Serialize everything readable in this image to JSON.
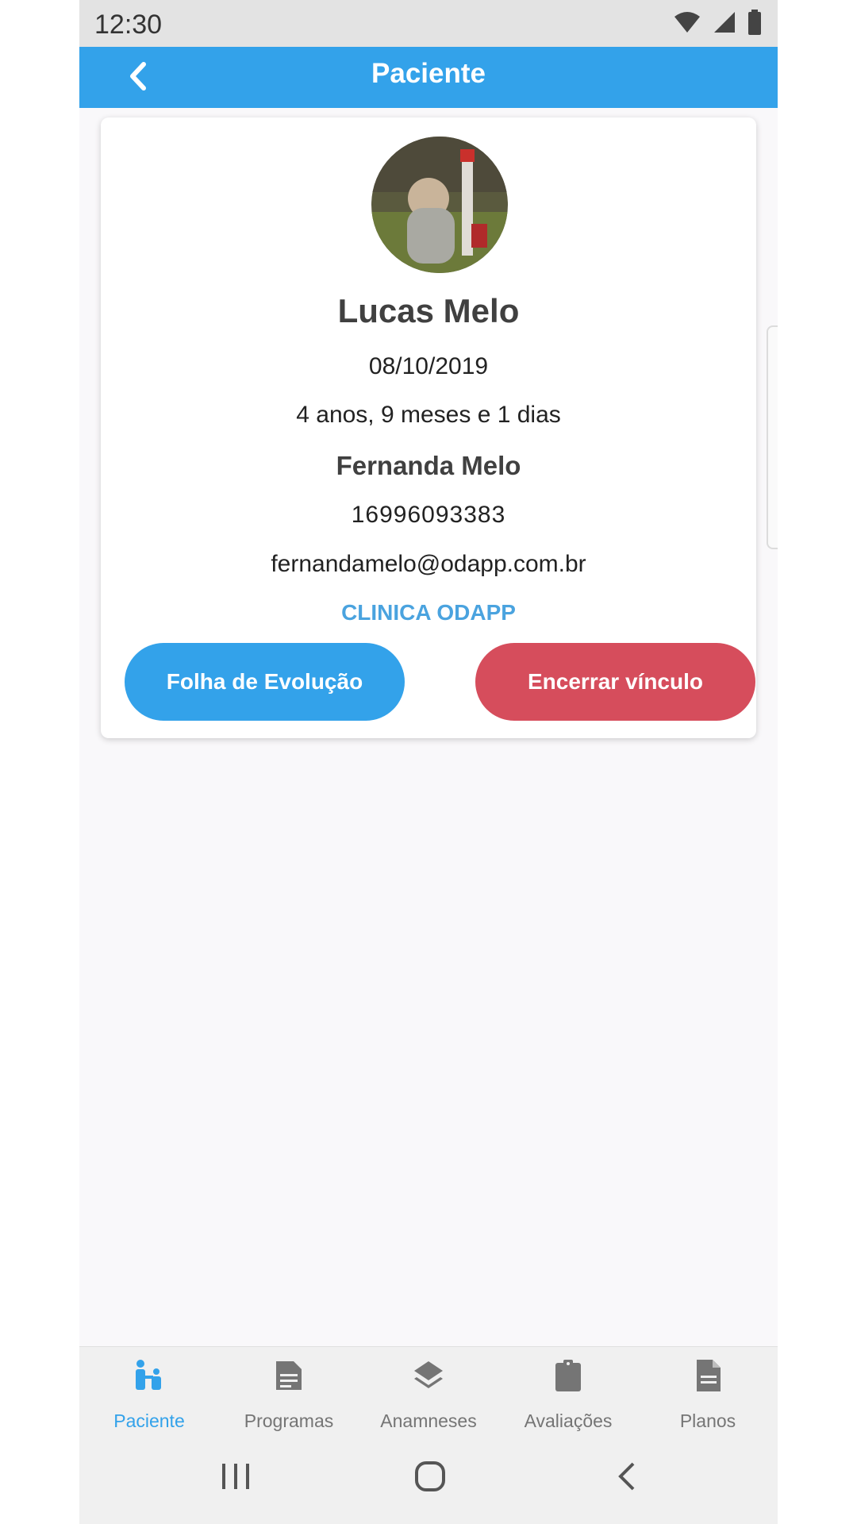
{
  "status_bar": {
    "time": "12:30"
  },
  "app_bar": {
    "title": "Paciente"
  },
  "patient": {
    "name": "Lucas Melo",
    "birth_date": "08/10/2019",
    "age": "4 anos, 9 meses e 1 dias",
    "guardian_name": "Fernanda Melo",
    "phone": "16996093383",
    "email": "fernandamelo@odapp.com.br",
    "clinic": "CLINICA ODAPP"
  },
  "actions": {
    "evolution_label": "Folha de Evolução",
    "end_link_label": "Encerrar vínculo"
  },
  "bottom_nav": {
    "items": [
      {
        "label": "Paciente",
        "icon": "patient-icon",
        "active": true
      },
      {
        "label": "Programas",
        "icon": "programs-icon"
      },
      {
        "label": "Anamneses",
        "icon": "layers-icon"
      },
      {
        "label": "Avaliações",
        "icon": "clipboard-icon"
      },
      {
        "label": "Planos",
        "icon": "document-icon"
      }
    ]
  },
  "colors": {
    "primary": "#33a2ea",
    "danger": "#d64d5c",
    "clinic_text": "#4aa3df",
    "background": "#f9f8fa"
  }
}
